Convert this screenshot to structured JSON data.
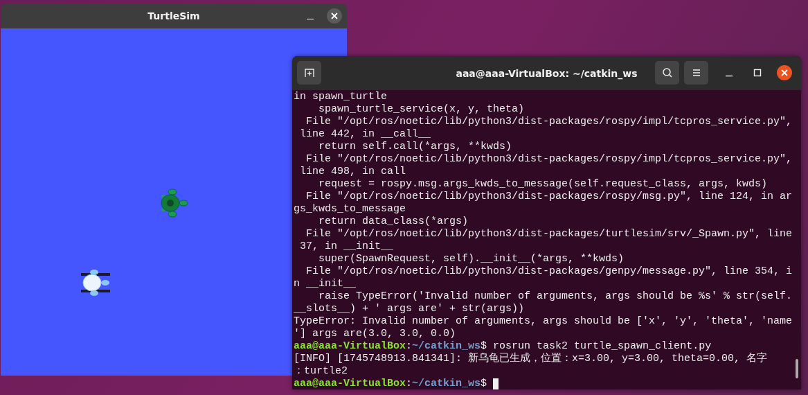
{
  "turtlesim": {
    "title": "TurtleSim",
    "turtles": [
      {
        "kind": "green"
      },
      {
        "kind": "white"
      }
    ]
  },
  "terminal": {
    "title": "aaa@aaa-VirtualBox: ~/catkin_ws",
    "lines": [
      {
        "kind": "output",
        "text": "in spawn_turtle"
      },
      {
        "kind": "output",
        "text": "    spawn_turtle_service(x, y, theta)"
      },
      {
        "kind": "output",
        "text": "  File \"/opt/ros/noetic/lib/python3/dist-packages/rospy/impl/tcpros_service.py\","
      },
      {
        "kind": "output",
        "text": " line 442, in __call__"
      },
      {
        "kind": "output",
        "text": "    return self.call(*args, **kwds)"
      },
      {
        "kind": "output",
        "text": "  File \"/opt/ros/noetic/lib/python3/dist-packages/rospy/impl/tcpros_service.py\","
      },
      {
        "kind": "output",
        "text": " line 498, in call"
      },
      {
        "kind": "output",
        "text": "    request = rospy.msg.args_kwds_to_message(self.request_class, args, kwds)"
      },
      {
        "kind": "output",
        "text": "  File \"/opt/ros/noetic/lib/python3/dist-packages/rospy/msg.py\", line 124, in ar"
      },
      {
        "kind": "output",
        "text": "gs_kwds_to_message"
      },
      {
        "kind": "output",
        "text": "    return data_class(*args)"
      },
      {
        "kind": "output",
        "text": "  File \"/opt/ros/noetic/lib/python3/dist-packages/turtlesim/srv/_Spawn.py\", line"
      },
      {
        "kind": "output",
        "text": " 37, in __init__"
      },
      {
        "kind": "output",
        "text": "    super(SpawnRequest, self).__init__(*args, **kwds)"
      },
      {
        "kind": "output",
        "text": "  File \"/opt/ros/noetic/lib/python3/dist-packages/genpy/message.py\", line 354, i"
      },
      {
        "kind": "output",
        "text": "n __init__"
      },
      {
        "kind": "output",
        "text": "    raise TypeError('Invalid number of arguments, args should be %s' % str(self."
      },
      {
        "kind": "output",
        "text": "__slots__) + ' args are' + str(args))"
      },
      {
        "kind": "output",
        "text": "TypeError: Invalid number of arguments, args should be ['x', 'y', 'theta', 'name"
      },
      {
        "kind": "output",
        "text": "'] args are(3.0, 3.0, 0.0)"
      },
      {
        "kind": "prompt",
        "user": "aaa@aaa-VirtualBox",
        "separator": ":",
        "path": "~/catkin_ws",
        "command": "$ rosrun task2 turtle_spawn_client.py",
        "cursor": false
      },
      {
        "kind": "output",
        "text": "[INFO] [1745748913.841341]: 新乌龟已生成，位置：x=3.00, y=3.00, theta=0.00, 名字"
      },
      {
        "kind": "output",
        "text": "：turtle2"
      },
      {
        "kind": "prompt",
        "user": "aaa@aaa-VirtualBox",
        "separator": ":",
        "path": "~/catkin_ws",
        "command": "$ ",
        "cursor": true
      }
    ]
  }
}
